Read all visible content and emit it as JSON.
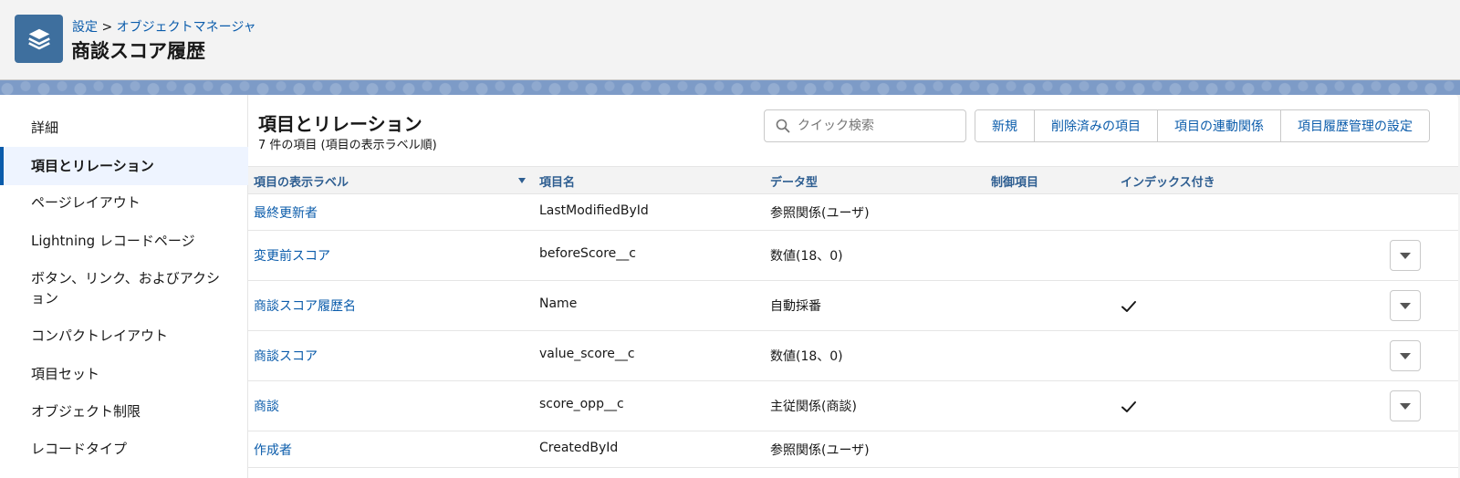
{
  "header": {
    "breadcrumb_root": "設定",
    "breadcrumb_sep": ">",
    "breadcrumb_current": "オブジェクトマネージャ",
    "title": "商談スコア履歴",
    "icon": "layers-icon",
    "icon_color": "#3e6f9e"
  },
  "sidebar": {
    "items": [
      {
        "label": "詳細",
        "active": false
      },
      {
        "label": "項目とリレーション",
        "active": true
      },
      {
        "label": "ページレイアウト",
        "active": false
      },
      {
        "label": "Lightning レコードページ",
        "active": false
      },
      {
        "label": "ボタン、リンク、およびアクション",
        "active": false
      },
      {
        "label": "コンパクトレイアウト",
        "active": false
      },
      {
        "label": "項目セット",
        "active": false
      },
      {
        "label": "オブジェクト制限",
        "active": false
      },
      {
        "label": "レコードタイプ",
        "active": false
      }
    ]
  },
  "section": {
    "title": "項目とリレーション",
    "count_text": "7 件の項目 (項目の表示ラベル順)"
  },
  "search": {
    "placeholder": "クイック検索",
    "value": ""
  },
  "toolbar": {
    "new_label": "新規",
    "deleted_fields_label": "削除済みの項目",
    "dependencies_label": "項目の連動関係",
    "history_tracking_label": "項目履歴管理の設定"
  },
  "table": {
    "columns": {
      "label": "項目の表示ラベル",
      "api_name": "項目名",
      "data_type": "データ型",
      "controlling": "制御項目",
      "indexed": "インデックス付き"
    },
    "sort_column": "label",
    "rows": [
      {
        "label": "最終更新者",
        "api_name": "LastModifiedById",
        "data_type": "参照関係(ユーザ)",
        "controlling": "",
        "indexed": false,
        "has_menu": false
      },
      {
        "label": "変更前スコア",
        "api_name": "beforeScore__c",
        "data_type": "数値(18、0)",
        "controlling": "",
        "indexed": false,
        "has_menu": true
      },
      {
        "label": "商談スコア履歴名",
        "api_name": "Name",
        "data_type": "自動採番",
        "controlling": "",
        "indexed": true,
        "has_menu": true
      },
      {
        "label": "商談スコア",
        "api_name": "value_score__c",
        "data_type": "数値(18、0)",
        "controlling": "",
        "indexed": false,
        "has_menu": true
      },
      {
        "label": "商談",
        "api_name": "score_opp__c",
        "data_type": "主従関係(商談)",
        "controlling": "",
        "indexed": true,
        "has_menu": true
      },
      {
        "label": "作成者",
        "api_name": "CreatedById",
        "data_type": "参照関係(ユーザ)",
        "controlling": "",
        "indexed": false,
        "has_menu": false
      }
    ]
  },
  "colors": {
    "link": "#0b5cab",
    "header_text": "#2e5e91",
    "active_bg": "#eef4ff",
    "band": "#7d9bc7"
  }
}
